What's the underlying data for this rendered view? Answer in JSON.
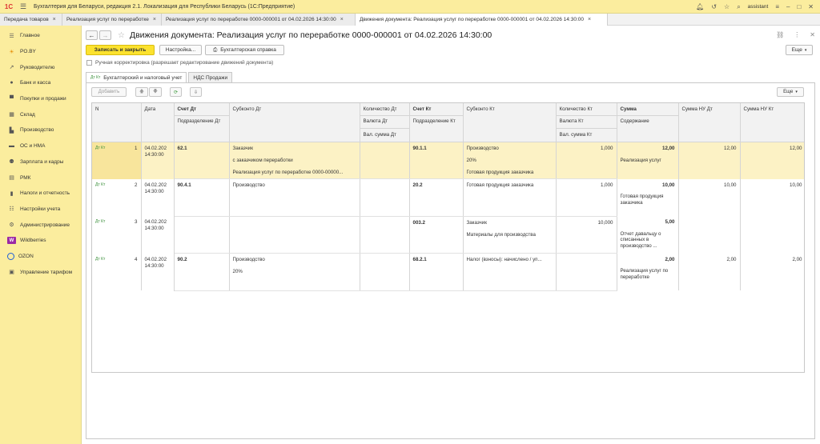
{
  "app": {
    "logo": "1С",
    "title": "Бухгалтерия для Беларуси, редакция 2.1. Локализация для Республики Беларусь  (1С:Предприятие)",
    "user": "assistant"
  },
  "window_tabs": [
    {
      "label": "Передача товаров"
    },
    {
      "label": "Реализация услуг по переработке"
    },
    {
      "label": "Реализация услуг по переработке 0000-000001 от 04.02.2026 14:30:00"
    },
    {
      "label": "Движения документа: Реализация услуг по переработке 0000-000001 от 04.02.2026 14:30:00"
    }
  ],
  "sidebar": {
    "items": [
      {
        "label": "Главное",
        "icon": "menu-icon"
      },
      {
        "label": "PO.BY",
        "icon": "sun-icon"
      },
      {
        "label": "Руководителю",
        "icon": "trend-icon"
      },
      {
        "label": "Банк и касса",
        "icon": "coins-icon"
      },
      {
        "label": "Покупки и продажи",
        "icon": "cart-icon"
      },
      {
        "label": "Склад",
        "icon": "warehouse-icon"
      },
      {
        "label": "Производство",
        "icon": "factory-icon"
      },
      {
        "label": "ОС и НМА",
        "icon": "truck-icon"
      },
      {
        "label": "Зарплата и кадры",
        "icon": "people-icon"
      },
      {
        "label": "РМК",
        "icon": "register-icon"
      },
      {
        "label": "Налоги и отчетность",
        "icon": "report-icon"
      },
      {
        "label": "Настройки учета",
        "icon": "settings-list-icon"
      },
      {
        "label": "Администрирование",
        "icon": "gear-icon"
      },
      {
        "label": "Wildberries",
        "icon": "wildberries-icon"
      },
      {
        "label": "OZON",
        "icon": "ozon-icon"
      },
      {
        "label": "Управление тарифом",
        "icon": "tariff-icon"
      }
    ]
  },
  "form": {
    "title": "Движения документа: Реализация услуг по переработке 0000-000001 от 04.02.2026 14:30:00",
    "buttons": {
      "save_close": "Записать и закрыть",
      "settings": "Настройка...",
      "accounting_ref": "Бухгалтерская справка",
      "more": "Еще"
    },
    "manual_correction": "Ручная корректировка (разрешает редактирование движений документа)",
    "tabs": [
      {
        "label": "Бухгалтерский и налоговый учет",
        "active": true
      },
      {
        "label": "НДС Продажи",
        "active": false
      }
    ],
    "table_toolbar": {
      "add": "Добавить",
      "more": "Еще"
    }
  },
  "grid": {
    "headers": {
      "n": "N",
      "date": "Дата",
      "acc_dt": "Счет Дт",
      "sub_dt": "Субконто Дт",
      "qty_dt": "Количество Дт",
      "acc_kt": "Счет Кт",
      "sub_kt": "Субконто Кт",
      "qty_kt": "Количество Кт",
      "sum": "Сумма",
      "sum_nu_dt": "Сумма НУ Дт",
      "sum_nu_kt": "Сумма НУ Кт",
      "dept_dt": "Подразделение Дт",
      "cur_dt": "Валюта Дт",
      "dept_kt": "Подразделение Кт",
      "cur_kt": "Валюта Кт",
      "content": "Содержание",
      "cursum_dt": "Вал. сумма Дт",
      "cursum_kt": "Вал. сумма Кт"
    },
    "rows": [
      {
        "n": "1",
        "date": "04.02.202",
        "time": "14:30:00",
        "acc_dt": "62.1",
        "sub_dt": [
          "Заказчик",
          "с заказчиком переработки",
          "Реализация услуг по переработке 0000-00000..."
        ],
        "acc_kt": "90.1.1",
        "sub_kt": [
          "Производство",
          "20%",
          "Готовая продукция заказчика"
        ],
        "qty_kt": "1,000",
        "sum": "12,00",
        "content": "Реализация услуг",
        "nu_dt": "12,00",
        "nu_kt": "12,00"
      },
      {
        "n": "2",
        "date": "04.02.202",
        "time": "14:30:00",
        "acc_dt": "90.4.1",
        "sub_dt": [
          "Производство",
          "",
          ""
        ],
        "acc_kt": "20.2",
        "sub_kt": [
          "Готовая продукция заказчика",
          "",
          ""
        ],
        "qty_kt": "1,000",
        "sum": "10,00",
        "content": "Готовая продукция заказчика",
        "nu_dt": "10,00",
        "nu_kt": "10,00"
      },
      {
        "n": "3",
        "date": "04.02.202",
        "time": "14:30:00",
        "acc_dt": "",
        "sub_dt": [
          "",
          "",
          ""
        ],
        "acc_kt": "003.2",
        "sub_kt": [
          "Заказчик",
          "Материалы для производства",
          ""
        ],
        "qty_kt": "10,000",
        "sum": "5,00",
        "content": "Отчет давальцу о списанных в производство ...",
        "nu_dt": "",
        "nu_kt": ""
      },
      {
        "n": "4",
        "date": "04.02.202",
        "time": "14:30:00",
        "acc_dt": "90.2",
        "sub_dt": [
          "Производство",
          "20%",
          ""
        ],
        "acc_kt": "68.2.1",
        "sub_kt": [
          "Налог (взносы): начислено / уп...",
          "",
          ""
        ],
        "qty_kt": "",
        "sum": "2,00",
        "content": "Реализация услуг по переработке",
        "nu_dt": "2,00",
        "nu_kt": "2,00"
      }
    ],
    "row_icon": "Дт Кт"
  }
}
